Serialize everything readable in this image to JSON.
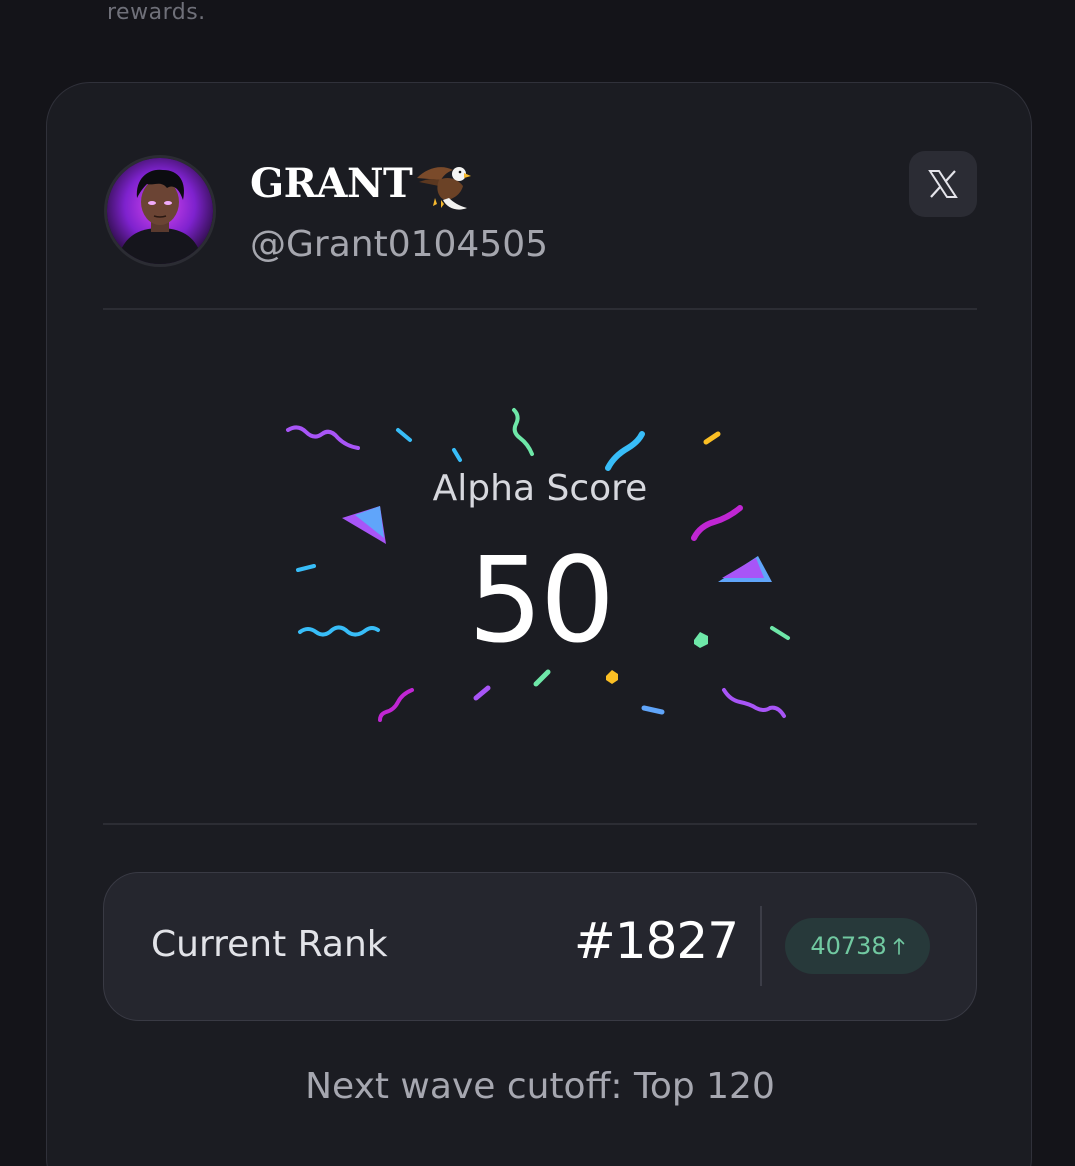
{
  "intro": {
    "text": "rewards."
  },
  "profile": {
    "display_name": "GRANT",
    "name_emoji": "eagle",
    "handle": "@Grant0104505",
    "social_icon": "x-logo-icon"
  },
  "score": {
    "label": "Alpha Score",
    "value": "50"
  },
  "rank": {
    "label": "Current Rank",
    "value": "#1827",
    "change": "40738",
    "change_direction_icon": "arrow-up-icon"
  },
  "cutoff": {
    "text": "Next wave cutoff: Top 120"
  },
  "colors": {
    "background": "#141419",
    "card": "#1b1c22",
    "rank_box": "#25262e",
    "badge_bg": "#27393a",
    "badge_text": "#71c9a1",
    "confetti": [
      "#a855f7",
      "#38bdf8",
      "#6ee7a8",
      "#fbbf24",
      "#60a5fa"
    ]
  }
}
